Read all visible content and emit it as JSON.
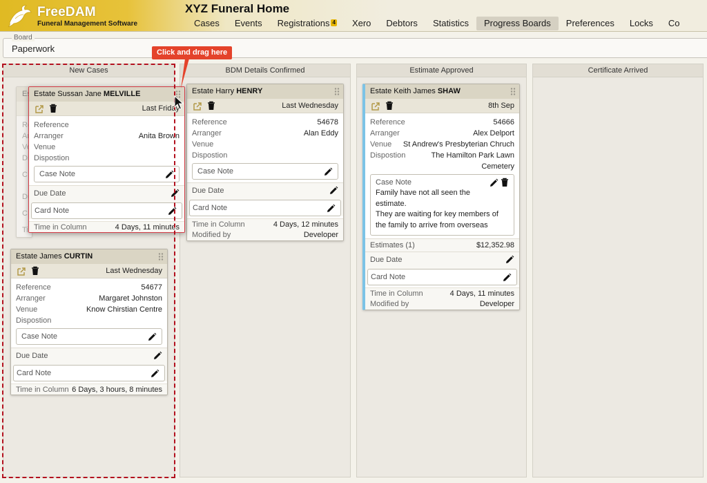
{
  "app": {
    "brand_name": "FreeDAM",
    "brand_tagline": "Funeral Management Software",
    "organization": "XYZ Funeral Home"
  },
  "nav": [
    {
      "label": "Cases"
    },
    {
      "label": "Events"
    },
    {
      "label": "Registrations",
      "badge": "4"
    },
    {
      "label": "Xero"
    },
    {
      "label": "Debtors"
    },
    {
      "label": "Statistics"
    },
    {
      "label": "Progress Boards",
      "active": true
    },
    {
      "label": "Preferences"
    },
    {
      "label": "Locks"
    },
    {
      "label": "Co"
    }
  ],
  "board": {
    "label": "Board",
    "value": "Paperwork"
  },
  "tooltip": {
    "text": "Click and drag here"
  },
  "columns": [
    {
      "title": "New Cases"
    },
    {
      "title": "BDM Details Confirmed"
    },
    {
      "title": "Estimate Approved"
    },
    {
      "title": "Certificate Arrived"
    }
  ],
  "labels": {
    "reference": "Reference",
    "arranger": "Arranger",
    "venue": "Venue",
    "dispostion": "Dispostion",
    "case_note": "Case Note",
    "due_date": "Due Date",
    "card_note": "Card Note",
    "time_in_column": "Time in Column",
    "modified_by": "Modified by",
    "estimates": "Estimates (1)"
  },
  "ghost_fragments": {
    "title": "Es",
    "reference": "Re",
    "arranger": "Ar",
    "venue": "Ve",
    "dispostion": "Di",
    "case_note": "C",
    "due_date": "Du",
    "card_note": "C",
    "time_in_column": "Ti"
  },
  "cards": {
    "melville": {
      "title_prefix": "Estate Sussan Jane",
      "title_surname": "MELVILLE",
      "date": "Last Friday",
      "reference": "",
      "arranger": "Anita Brown",
      "venue": "",
      "dispostion": "",
      "time_in_column": "4 Days, 11 minutes"
    },
    "curtin": {
      "title_prefix": "Estate James",
      "title_surname": "CURTIN",
      "date": "Last Wednesday",
      "reference": "54677",
      "arranger": "Margaret Johnston",
      "venue": "Know Chirstian Centre",
      "dispostion": "",
      "time_in_column": "6 Days, 3 hours, 8 minutes"
    },
    "henry": {
      "title_prefix": "Estate Harry",
      "title_surname": "HENRY",
      "date": "Last Wednesday",
      "reference": "54678",
      "arranger": "Alan Eddy",
      "venue": "",
      "dispostion": "",
      "time_in_column": "4 Days, 12 minutes",
      "modified_by": "Developer"
    },
    "shaw": {
      "title_prefix": "Estate Keith James",
      "title_surname": "SHAW",
      "date": "8th Sep",
      "reference": "54666",
      "arranger": "Alex Delport",
      "venue": "St Andrew's Presbyterian Chruch",
      "dispostion": "The Hamilton Park Lawn Cemetery",
      "case_note_line1": "Family have not all seen the estimate.",
      "case_note_line2": "They are waiting for key members of the family to arrive from overseas",
      "estimates_total": "$12,352.98",
      "time_in_column": "4 Days, 11 minutes",
      "modified_by": "Developer"
    }
  },
  "colors": {
    "header_gold": "#e0ba23",
    "drop_outline": "#b3101e",
    "tooltip": "#e4432b",
    "card_title_bg": "#dad5c4",
    "accent_stripe": "#7cc3e6"
  }
}
